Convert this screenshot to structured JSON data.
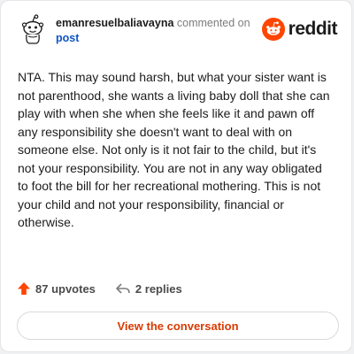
{
  "comment": {
    "username": "emanresuelbaliavayna",
    "action_text": "commented on",
    "target_link": "post",
    "body": "NTA. This may sound harsh, but what your sister want is not parenthood, she wants a living baby doll that she can play with when she when she feels like it and pawn off any responsibility she doesn't want to deal with on someone else. Not only is it not fair to the child, but it's not your responsibility. You are not in any way obligated to foot the bill for her recreational mothering. This is not your child and not your responsibility, financial or otherwise."
  },
  "brand": {
    "wordmark": "reddit",
    "accent_color": "#ff4500"
  },
  "stats": {
    "upvotes": "87 upvotes",
    "replies": "2 replies"
  },
  "cta": {
    "label": "View the conversation"
  },
  "icons": {
    "avatar": "snoo-avatar",
    "logo": "reddit-snoo-logo",
    "upvote": "upvote-arrow-icon",
    "reply": "reply-arrow-icon"
  }
}
